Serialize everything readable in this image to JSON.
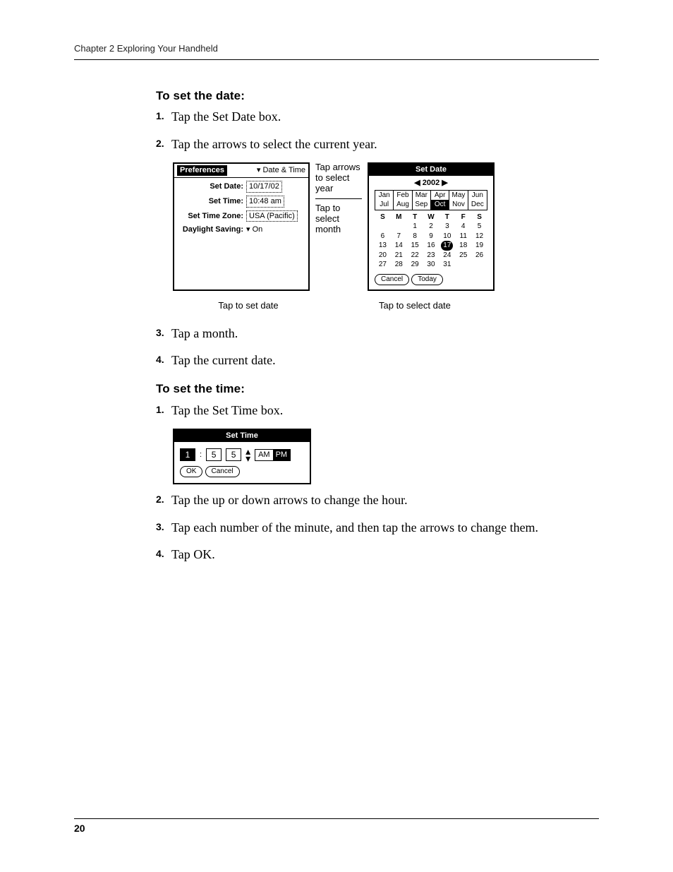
{
  "header": {
    "chapter_line": "Chapter 2    Exploring Your Handheld"
  },
  "page_number": "20",
  "section_date": {
    "heading": "To set the date:",
    "steps": [
      "Tap the Set Date box.",
      "Tap the arrows to select the current year.",
      "Tap a month.",
      "Tap the current date."
    ]
  },
  "section_time": {
    "heading": "To set the time:",
    "steps": [
      "Tap the Set Time box.",
      "Tap the up or down arrows to change the hour.",
      "Tap each number of the minute, and then tap the arrows to change them.",
      "Tap OK."
    ]
  },
  "prefs_panel": {
    "title_left": "Preferences",
    "title_right_menu": "▾ Date & Time",
    "rows": {
      "set_date_label": "Set Date:",
      "set_date_value": "10/17/02",
      "set_time_label": "Set Time:",
      "set_time_value": "10:48 am",
      "set_tz_label": "Set Time Zone:",
      "set_tz_value": "USA (Pacific)",
      "dst_label": "Daylight Saving:",
      "dst_value": "▾ On"
    }
  },
  "annotations": {
    "tap_arrows": "Tap arrows to select year",
    "tap_month": "Tap to select month",
    "caption_left": "Tap to set date",
    "caption_right": "Tap to select date"
  },
  "setdate_panel": {
    "title": "Set Date",
    "year_nav": "◀  2002  ▶",
    "months": [
      "Jan",
      "Feb",
      "Mar",
      "Apr",
      "May",
      "Jun",
      "Jul",
      "Aug",
      "Sep",
      "Oct",
      "Nov",
      "Dec"
    ],
    "month_selected": "Oct",
    "dow": [
      "S",
      "M",
      "T",
      "W",
      "T",
      "F",
      "S"
    ],
    "weeks": [
      [
        "",
        "",
        "1",
        "2",
        "3",
        "4",
        "5"
      ],
      [
        "6",
        "7",
        "8",
        "9",
        "10",
        "11",
        "12"
      ],
      [
        "13",
        "14",
        "15",
        "16",
        "17",
        "18",
        "19"
      ],
      [
        "20",
        "21",
        "22",
        "23",
        "24",
        "25",
        "26"
      ],
      [
        "27",
        "28",
        "29",
        "30",
        "31",
        "",
        ""
      ]
    ],
    "today_value": "17",
    "buttons": {
      "cancel": "Cancel",
      "today": "Today"
    }
  },
  "settime_panel": {
    "title": "Set Time",
    "hour": "1",
    "min_tens": "5",
    "min_ones": "5",
    "am": "AM",
    "pm": "PM",
    "ok": "OK",
    "cancel": "Cancel"
  }
}
